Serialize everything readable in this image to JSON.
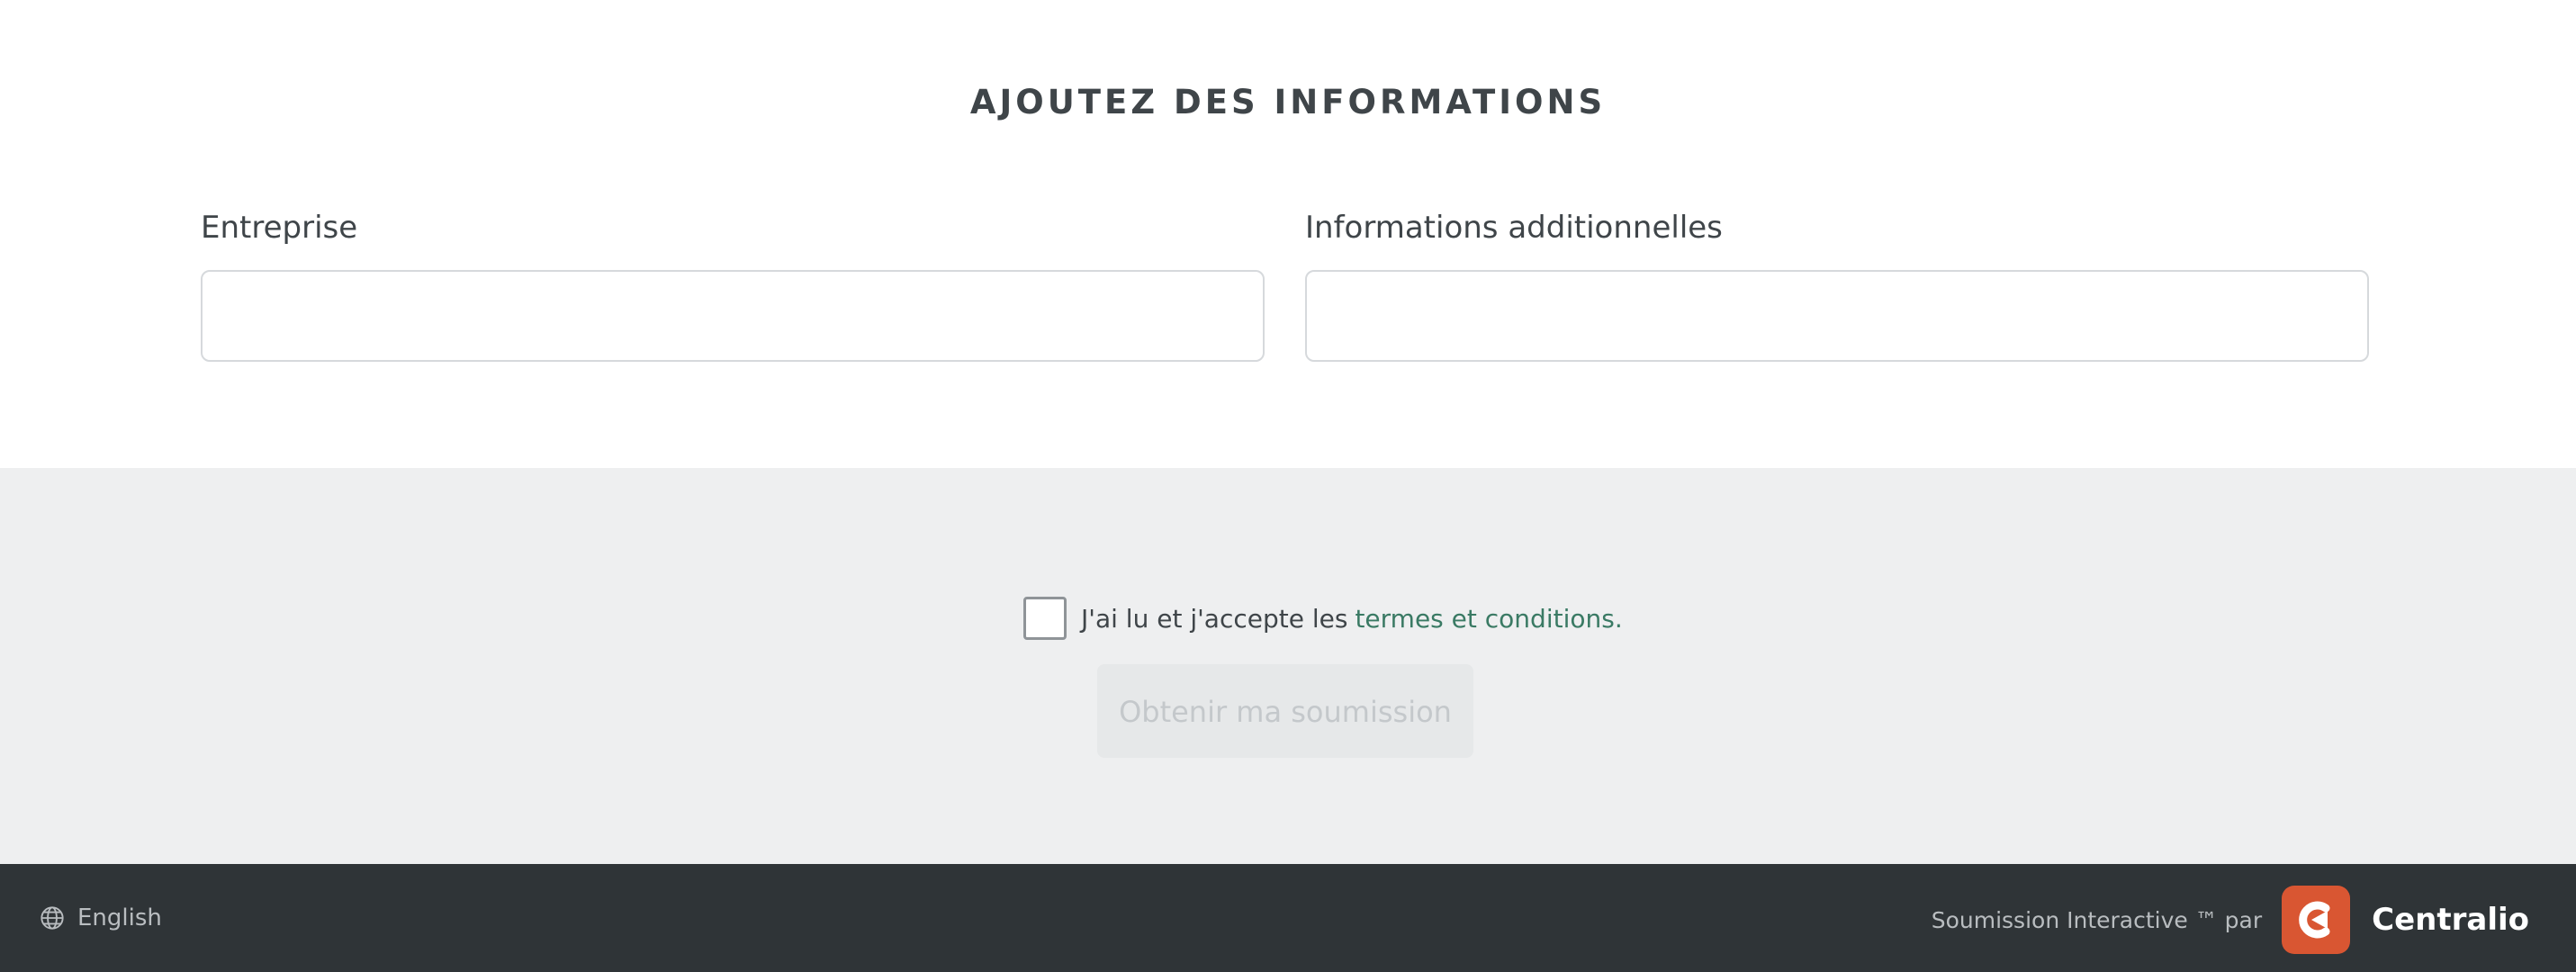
{
  "form": {
    "title": "AJOUTEZ DES INFORMATIONS",
    "company": {
      "label": "Entreprise",
      "value": ""
    },
    "additional_info": {
      "label": "Informations additionnelles",
      "value": ""
    }
  },
  "terms": {
    "checked": false,
    "text": "J'ai lu et j'accepte les",
    "link_label": "termes et conditions."
  },
  "submit": {
    "label": "Obtenir ma soumission",
    "disabled": true
  },
  "footer": {
    "language_label": "English",
    "language_icon": "globe-icon",
    "powered_by": "Soumission Interactive ™ par",
    "brand_name": "Centralio",
    "brand_color": "#d95632"
  },
  "colors": {
    "footer_background": "#2f3437",
    "section_background": "#eeeff0",
    "link": "#3a7a64"
  }
}
